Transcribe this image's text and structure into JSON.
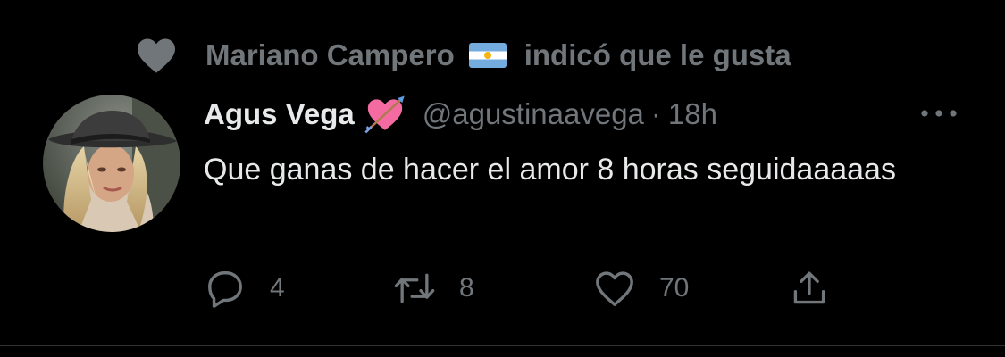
{
  "social_context": {
    "user": "Mariano Campero",
    "flag": "argentina-flag-emoji",
    "text": "indicó que le gusta"
  },
  "tweet": {
    "author_name": "Agus Vega",
    "author_emoji": "heart-with-arrow-emoji",
    "handle": "@agustinaavega",
    "separator": "·",
    "time": "18h",
    "text": "Que ganas de hacer el amor 8 horas seguidaaaaas"
  },
  "actions": {
    "reply_count": "4",
    "retweet_count": "8",
    "like_count": "70"
  },
  "icons": {
    "liked_by": "heart-icon",
    "more": "more-options-icon",
    "reply": "reply-icon",
    "retweet": "retweet-icon",
    "like": "like-icon",
    "share": "share-icon"
  },
  "colors": {
    "background": "#000000",
    "primary_text": "#e7e9ea",
    "secondary_text": "#71767b"
  }
}
